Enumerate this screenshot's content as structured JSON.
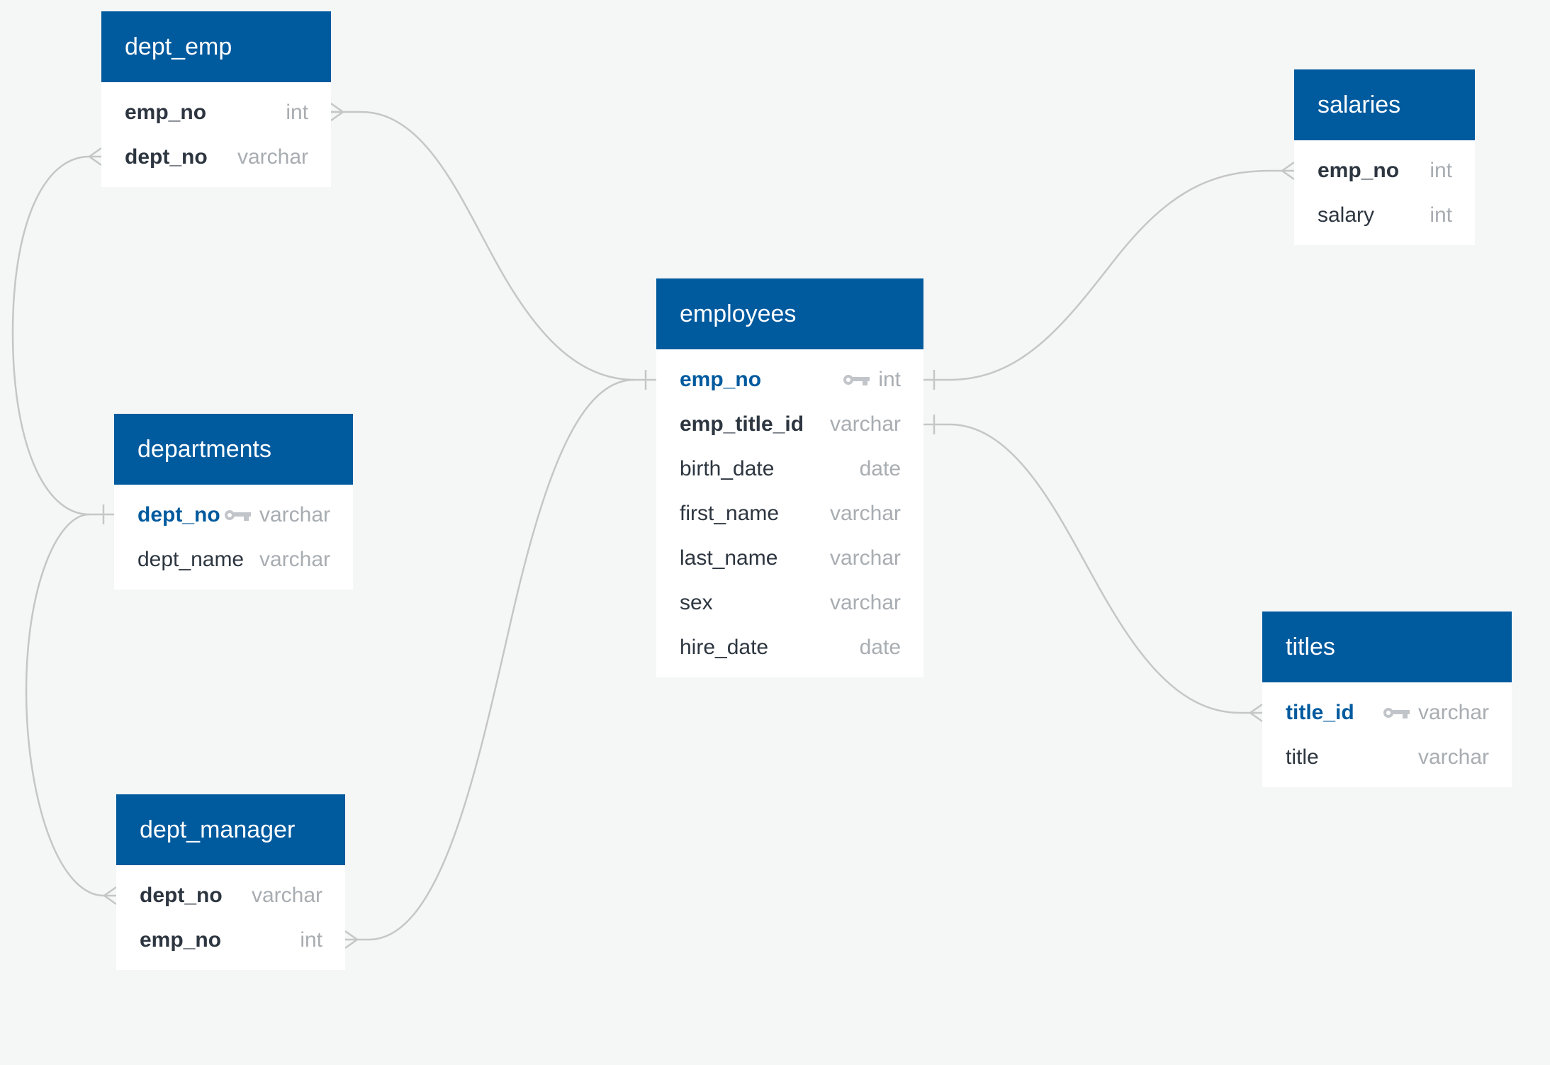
{
  "diagram": {
    "colors": {
      "header_bg": "#005a9e",
      "header_text": "#ffffff",
      "primary_key_text": "#005a9e",
      "field_text": "#2d3640",
      "type_text": "#a8adb2",
      "connector": "#c6c6c6",
      "background": "#f5f6f6"
    },
    "tables": {
      "dept_emp": {
        "title": "dept_emp",
        "fields": [
          {
            "name": "emp_no",
            "type": "int",
            "style": "bold"
          },
          {
            "name": "dept_no",
            "type": "varchar",
            "style": "bold"
          }
        ]
      },
      "departments": {
        "title": "departments",
        "fields": [
          {
            "name": "dept_no",
            "type": "varchar",
            "style": "pk",
            "icon": "key-icon"
          },
          {
            "name": "dept_name",
            "type": "varchar",
            "style": "normal"
          }
        ]
      },
      "dept_manager": {
        "title": "dept_manager",
        "fields": [
          {
            "name": "dept_no",
            "type": "varchar",
            "style": "bold"
          },
          {
            "name": "emp_no",
            "type": "int",
            "style": "bold"
          }
        ]
      },
      "employees": {
        "title": "employees",
        "fields": [
          {
            "name": "emp_no",
            "type": "int",
            "style": "pk",
            "icon": "key-icon"
          },
          {
            "name": "emp_title_id",
            "type": "varchar",
            "style": "bold"
          },
          {
            "name": "birth_date",
            "type": "date",
            "style": "normal"
          },
          {
            "name": "first_name",
            "type": "varchar",
            "style": "normal"
          },
          {
            "name": "last_name",
            "type": "varchar",
            "style": "normal"
          },
          {
            "name": "sex",
            "type": "varchar",
            "style": "normal"
          },
          {
            "name": "hire_date",
            "type": "date",
            "style": "normal"
          }
        ]
      },
      "salaries": {
        "title": "salaries",
        "fields": [
          {
            "name": "emp_no",
            "type": "int",
            "style": "bold"
          },
          {
            "name": "salary",
            "type": "int",
            "style": "normal"
          }
        ]
      },
      "titles": {
        "title": "titles",
        "fields": [
          {
            "name": "title_id",
            "type": "varchar",
            "style": "pk",
            "icon": "key-icon"
          },
          {
            "name": "title",
            "type": "varchar",
            "style": "normal"
          }
        ]
      }
    },
    "relationships": [
      {
        "from": "dept_emp.emp_no",
        "to": "employees.emp_no",
        "from_card": "many",
        "to_card": "one"
      },
      {
        "from": "dept_emp.dept_no",
        "to": "departments.dept_no",
        "from_card": "many",
        "to_card": "one"
      },
      {
        "from": "dept_manager.dept_no",
        "to": "departments.dept_no",
        "from_card": "many",
        "to_card": "one"
      },
      {
        "from": "dept_manager.emp_no",
        "to": "employees.emp_no",
        "from_card": "many",
        "to_card": "one"
      },
      {
        "from": "salaries.emp_no",
        "to": "employees.emp_no",
        "from_card": "many",
        "to_card": "one"
      },
      {
        "from": "titles.title_id",
        "to": "employees.emp_title_id",
        "from_card": "many",
        "to_card": "one"
      }
    ]
  }
}
